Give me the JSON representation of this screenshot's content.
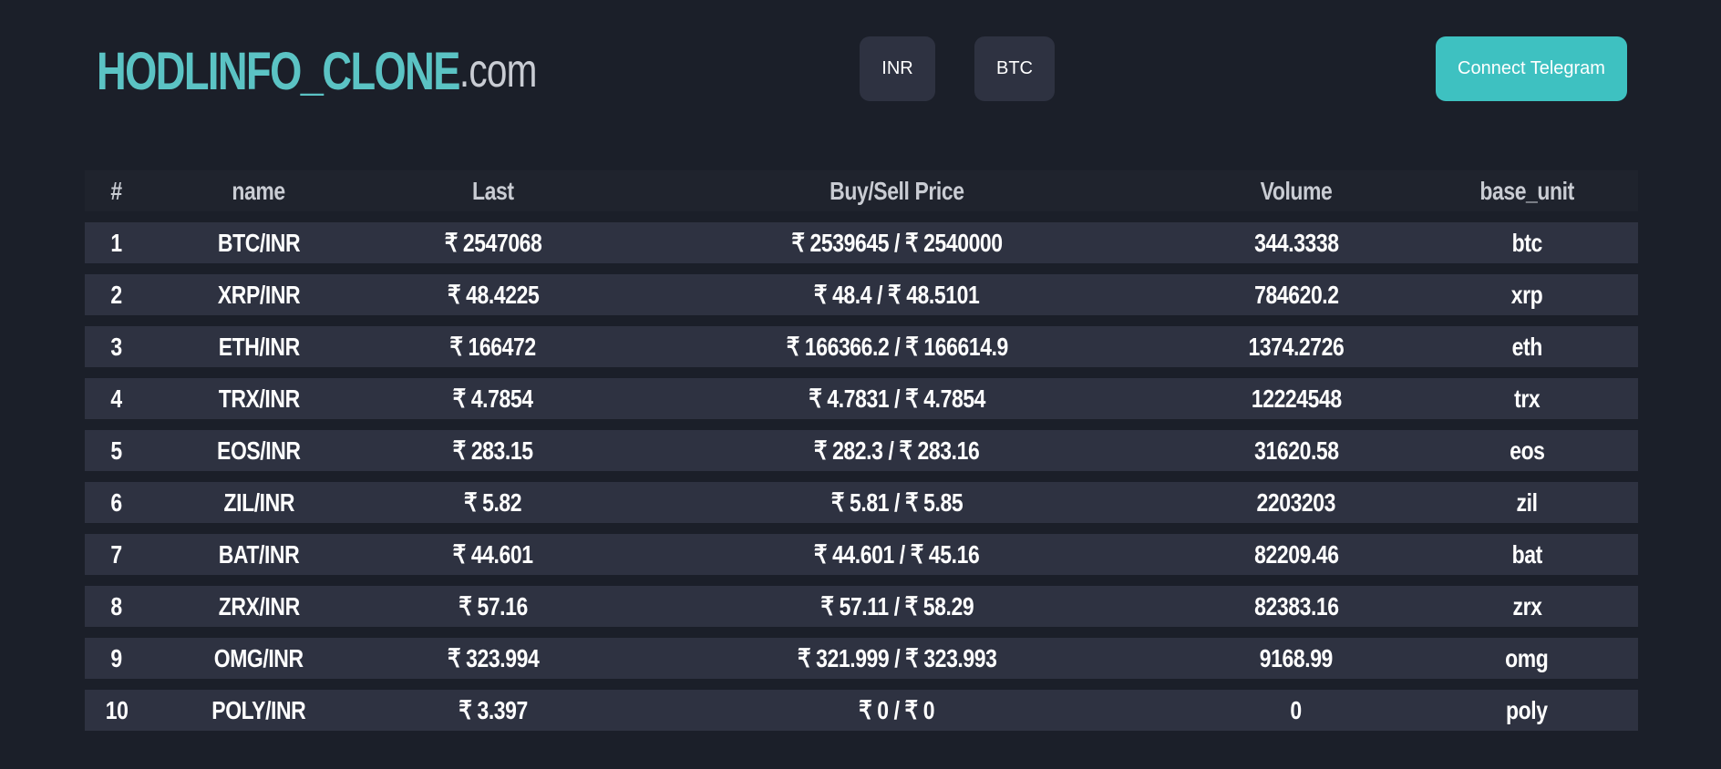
{
  "header": {
    "brand_main": "HODLINFO_CLONE",
    "brand_tld": ".com",
    "currency_buttons": [
      "INR",
      "BTC"
    ],
    "telegram_label": "Connect Telegram"
  },
  "table": {
    "columns": [
      "#",
      "name",
      "Last",
      "Buy/Sell Price",
      "Volume",
      "base_unit"
    ],
    "rows": [
      {
        "idx": "1",
        "name": "BTC/INR",
        "last": "₹ 2547068",
        "buy_sell": "₹ 2539645 / ₹ 2540000",
        "volume": "344.3338",
        "base_unit": "btc"
      },
      {
        "idx": "2",
        "name": "XRP/INR",
        "last": "₹ 48.4225",
        "buy_sell": "₹ 48.4 / ₹ 48.5101",
        "volume": "784620.2",
        "base_unit": "xrp"
      },
      {
        "idx": "3",
        "name": "ETH/INR",
        "last": "₹ 166472",
        "buy_sell": "₹ 166366.2 / ₹ 166614.9",
        "volume": "1374.2726",
        "base_unit": "eth"
      },
      {
        "idx": "4",
        "name": "TRX/INR",
        "last": "₹ 4.7854",
        "buy_sell": "₹ 4.7831 / ₹ 4.7854",
        "volume": "12224548",
        "base_unit": "trx"
      },
      {
        "idx": "5",
        "name": "EOS/INR",
        "last": "₹ 283.15",
        "buy_sell": "₹ 282.3 / ₹ 283.16",
        "volume": "31620.58",
        "base_unit": "eos"
      },
      {
        "idx": "6",
        "name": "ZIL/INR",
        "last": "₹ 5.82",
        "buy_sell": "₹ 5.81 / ₹ 5.85",
        "volume": "2203203",
        "base_unit": "zil"
      },
      {
        "idx": "7",
        "name": "BAT/INR",
        "last": "₹ 44.601",
        "buy_sell": "₹ 44.601 / ₹ 45.16",
        "volume": "82209.46",
        "base_unit": "bat"
      },
      {
        "idx": "8",
        "name": "ZRX/INR",
        "last": "₹ 57.16",
        "buy_sell": "₹ 57.11 / ₹ 58.29",
        "volume": "82383.16",
        "base_unit": "zrx"
      },
      {
        "idx": "9",
        "name": "OMG/INR",
        "last": "₹ 323.994",
        "buy_sell": "₹ 321.999 / ₹ 323.993",
        "volume": "9168.99",
        "base_unit": "omg"
      },
      {
        "idx": "10",
        "name": "POLY/INR",
        "last": "₹ 3.397",
        "buy_sell": "₹ 0 / ₹ 0",
        "volume": "0",
        "base_unit": "poly"
      }
    ]
  }
}
